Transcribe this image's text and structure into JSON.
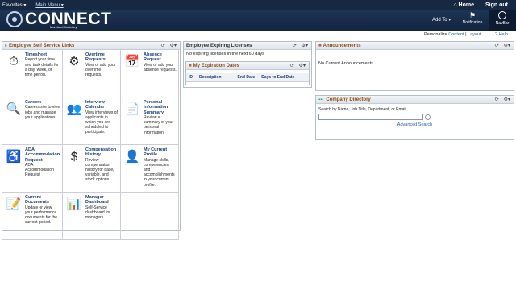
{
  "top": {
    "favorites": "Favorites ▾",
    "main_menu": "Main Menu ▾",
    "home": "⌂ Home",
    "signout": "Sign out"
  },
  "banner": {
    "logo": "CONNECT",
    "subtitle": "Maryland Judiciary",
    "add_to": "Add To ▾",
    "notification": "Notification",
    "navbar": "NavBar"
  },
  "personalize": {
    "prefix": "Personalize",
    "content": "Content",
    "sep": " | ",
    "layout": "Layout",
    "help": "? Help"
  },
  "ess": {
    "title": "Employee Self Service Links",
    "items": [
      {
        "title": "Timesheet",
        "desc": "Report your time and task details for a day, week, or time period.",
        "icon": "⏱"
      },
      {
        "title": "Overtime Requests",
        "desc": "View or add your overtime requests.",
        "icon": "⚙"
      },
      {
        "title": "Absence Request",
        "desc": "View or add your absence requests.",
        "icon": "📅"
      },
      {
        "title": "Careers",
        "desc": "Careers site to view jobs and manage your applications.",
        "icon": "🔍"
      },
      {
        "title": "Interview Calendar",
        "desc": "View interviews of applicants in which you are scheduled to participate.",
        "icon": "👥"
      },
      {
        "title": "Personal Information Summary",
        "desc": "Review a summary of your personal information.",
        "icon": "📄"
      },
      {
        "title": "ADA Accommodation Request",
        "desc": "ADA Accommodation Request",
        "icon": "♿"
      },
      {
        "title": "Compensation History",
        "desc": "Review compensation history for base, variable, and stock options.",
        "icon": "$"
      },
      {
        "title": "My Current Profile",
        "desc": "Manage skills, competencies, and accomplishments in your current profile.",
        "icon": "👤"
      },
      {
        "title": "Current Documents",
        "desc": "Update or view your performance documents for the current period.",
        "icon": "📝"
      },
      {
        "title": "Manager Dashboard",
        "desc": "Self-Service dashboard for managers.",
        "icon": "📊"
      },
      {
        "title": "",
        "desc": "",
        "icon": ""
      }
    ]
  },
  "licenses": {
    "title": "Employee Expiring Licenses",
    "message": "No expiring licenses in the next 60 days"
  },
  "exp": {
    "title": "My Expiration Dates",
    "cols": [
      "ID",
      "Description",
      "End Date",
      "Days to End Date"
    ]
  },
  "ann": {
    "title": "Announcements",
    "message": "No Current Announcements."
  },
  "dir": {
    "title": "Company Directory",
    "label": "Search by Name, Job Title, Department, or Email",
    "advanced": "Advanced Search"
  },
  "colors": {
    "header_bg": "#162842",
    "title_text": "#8a4a16",
    "link": "#2a5ea8"
  }
}
